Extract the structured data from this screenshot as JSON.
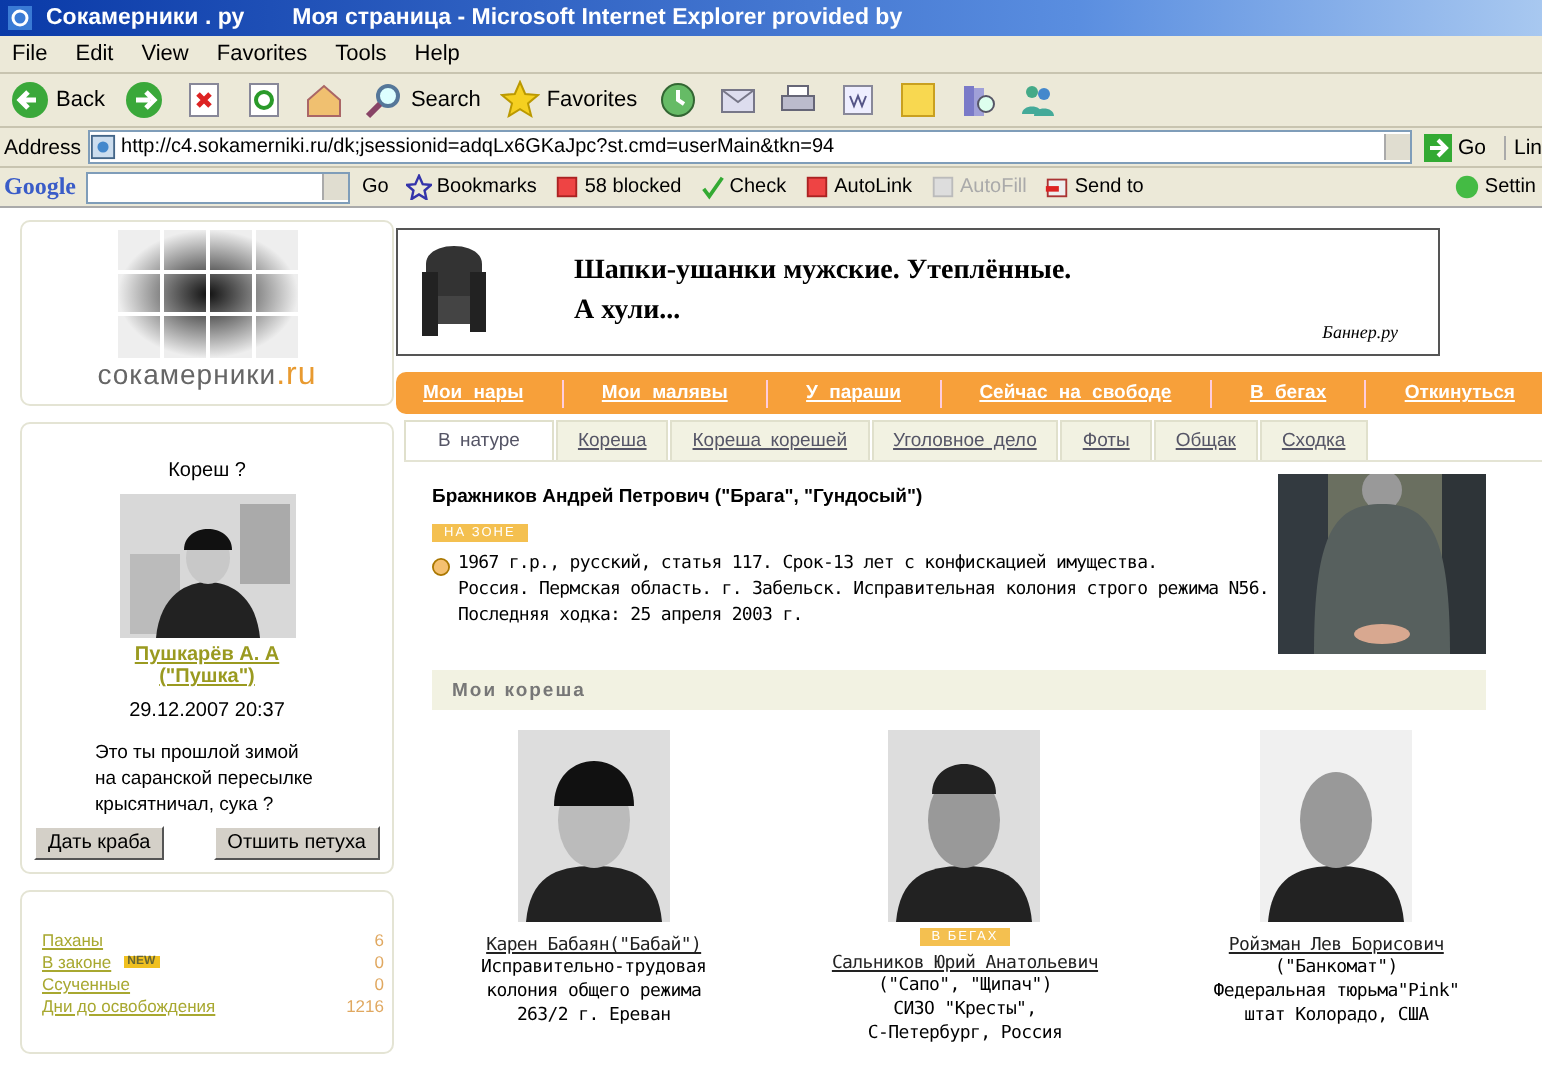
{
  "window": {
    "site": "Сокамерники . ру",
    "title": "Моя страница - Microsoft Internet Explorer provided by"
  },
  "menu": [
    "File",
    "Edit",
    "View",
    "Favorites",
    "Tools",
    "Help"
  ],
  "toolbar": [
    {
      "kind": "back",
      "label": "Back"
    },
    {
      "kind": "forward"
    },
    {
      "kind": "stop"
    },
    {
      "kind": "refresh"
    },
    {
      "kind": "home"
    },
    {
      "kind": "search",
      "label": "Search"
    },
    {
      "kind": "favorites",
      "label": "Favorites"
    },
    {
      "kind": "history"
    },
    {
      "kind": "mail"
    },
    {
      "kind": "print"
    },
    {
      "kind": "edit"
    },
    {
      "kind": "note"
    },
    {
      "kind": "research"
    },
    {
      "kind": "messenger"
    }
  ],
  "address": {
    "label": "Address",
    "value": "http://c4.sokamerniki.ru/dk;jsessionid=adqLx6GKaJpc?st.cmd=userMain&tkn=94",
    "go": "Go",
    "links": "Lin"
  },
  "google_bar": {
    "logo": "Google",
    "go": "Go",
    "items": [
      {
        "kind": "bookmarks",
        "label": "Bookmarks",
        "disabled": false
      },
      {
        "kind": "blocked",
        "label": "58 blocked",
        "disabled": false
      },
      {
        "kind": "check",
        "label": "Check",
        "disabled": false
      },
      {
        "kind": "autolink",
        "label": "AutoLink",
        "disabled": false
      },
      {
        "kind": "autofill",
        "label": "AutoFill",
        "disabled": true
      },
      {
        "kind": "sendto",
        "label": "Send to",
        "disabled": false
      }
    ],
    "settings": "Settin"
  },
  "logo": {
    "name": "сокамерники",
    "tld": ".ru"
  },
  "banner": {
    "lines": [
      "Шапки-ушанки мужские. Утеплённые.",
      "А хули..."
    ],
    "source": "Баннер.ру"
  },
  "nav": [
    "Мои нары",
    "Мои малявы",
    "У параши",
    "Сейчас на свободе",
    "В бегах",
    "Откинуться"
  ],
  "tabs": [
    {
      "label": "В натуре",
      "selected": true
    },
    {
      "label": "Кореша",
      "selected": false
    },
    {
      "label": "Кореша корешей",
      "selected": false
    },
    {
      "label": "Уголовное дело",
      "selected": false
    },
    {
      "label": "Фоты",
      "selected": false
    },
    {
      "label": "Общак",
      "selected": false
    },
    {
      "label": "Сходка",
      "selected": false
    }
  ],
  "request": {
    "question": "Кореш ?",
    "name": "Пушкарёв А. А",
    "nick": "(\"Пушка\")",
    "date": "29.12.2007 20:37",
    "message": "Это ты прошлой зимой на саранской пересылке крысятничал, сука ?",
    "buttons": [
      "Дать краба",
      "Отшить петуха"
    ]
  },
  "stats": [
    {
      "label": "Паханы",
      "value": "6"
    },
    {
      "label": "В законе",
      "value": "0",
      "badge": "NEW"
    },
    {
      "label": "Ссученные",
      "value": "0"
    },
    {
      "label": "Дни до освобождения",
      "value": "1216"
    }
  ],
  "profile": {
    "name": "Бражников Андрей Петрович (\"Брага\", \"Гундосый\")",
    "status": "НА ЗОНЕ",
    "info": [
      "1967 г.р., русский, статья 117. Срок-13 лет с конфискацией имущества.",
      "Россия. Пермская область. г. Забельск. Исправительная колония строго режима N56.",
      "Последняя ходка: 25 апреля 2003 г."
    ]
  },
  "friends_title": "Мои кореша",
  "friends": [
    {
      "name": "Карен Бабаян(\"Бабай\")",
      "lines": [
        "Исправительно-трудовая",
        "колония общего режима",
        "263/2 г. Ереван"
      ]
    },
    {
      "name": "Сальников Юрий Анатольевич",
      "badge": "В БЕГАХ",
      "lines": [
        "(\"Сапо\", \"Щипач\")",
        "СИЗО \"Кресты\",",
        "С-Петербург, Россия"
      ]
    },
    {
      "name": "Ройзман Лев Борисович",
      "lines": [
        "(\"Банкомат\")",
        "Федеральная тюрьма\"Pink\"",
        "штат Колорадо, США"
      ]
    }
  ]
}
